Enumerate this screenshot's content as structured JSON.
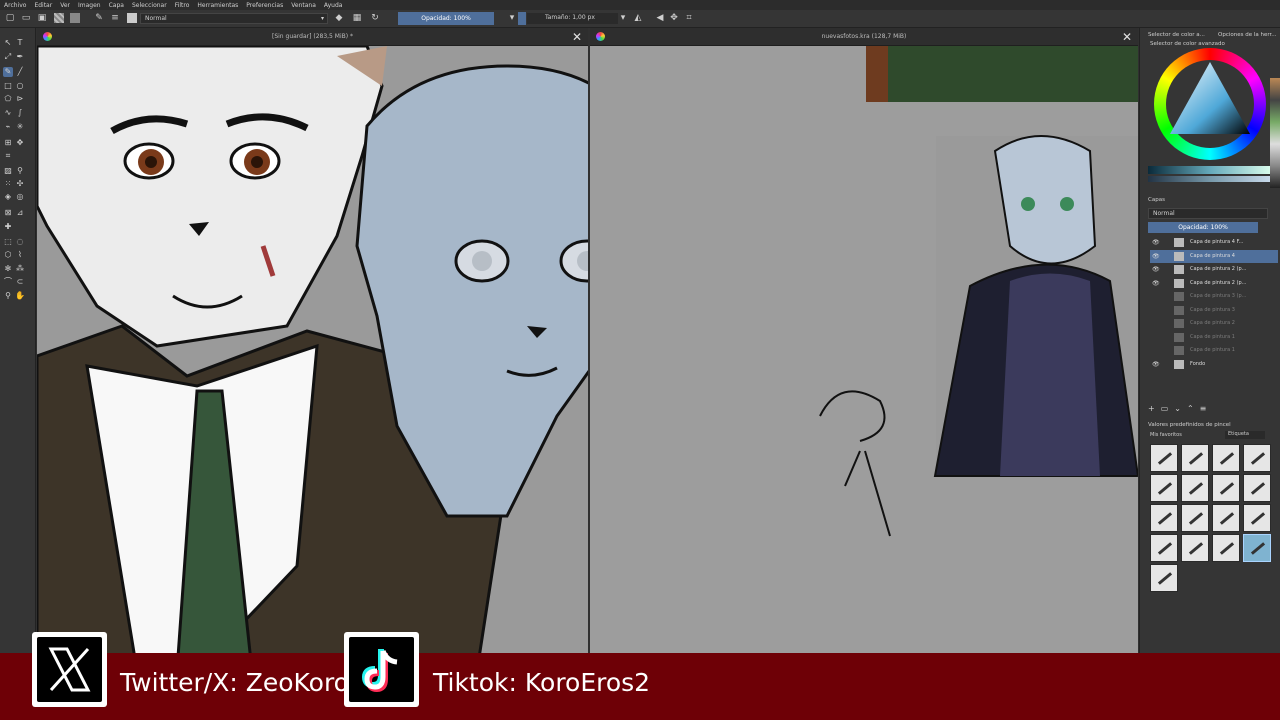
{
  "menu": {
    "items": [
      "Archivo",
      "Editar",
      "Ver",
      "Imagen",
      "Capa",
      "Seleccionar",
      "Filtro",
      "Herramientas",
      "Preferencias",
      "Ventana",
      "Ayuda"
    ]
  },
  "toolbar": {
    "blend_mode": "Normal",
    "opacity_label": "Opacidad: 100%",
    "size_label": "Tamaño: 1,00 px"
  },
  "canvases": [
    {
      "title": "[Sin guardar] (283,5 MiB) *"
    },
    {
      "title": "nuevasfotos.kra (128,7 MiB)"
    }
  ],
  "dock": {
    "color_panel_title": "Selector de color a...",
    "color_panel_title2": "Opciones de la herr...",
    "color_selector_label": "Selector de color avanzado",
    "layers_title": "Capas",
    "layers_blend": "Normal",
    "layers_opacity": "Opacidad: 100%",
    "layers": [
      {
        "name": "Capa de pintura 4 F...",
        "visible": true,
        "selected": false,
        "dim": false
      },
      {
        "name": "Capa de pintura 4",
        "visible": true,
        "selected": true,
        "dim": false
      },
      {
        "name": "Capa de pintura 2 (p...",
        "visible": true,
        "selected": false,
        "dim": false
      },
      {
        "name": "Capa de pintura 2 (p...",
        "visible": true,
        "selected": false,
        "dim": false
      },
      {
        "name": "Capa de pintura 3 (p...",
        "visible": false,
        "selected": false,
        "dim": true
      },
      {
        "name": "Capa de pintura 3",
        "visible": false,
        "selected": false,
        "dim": true
      },
      {
        "name": "Capa de pintura 2",
        "visible": false,
        "selected": false,
        "dim": true
      },
      {
        "name": "Capa de pintura 1",
        "visible": false,
        "selected": false,
        "dim": true
      },
      {
        "name": "Capa de pintura 1",
        "visible": false,
        "selected": false,
        "dim": true
      },
      {
        "name": "Fondo",
        "visible": true,
        "selected": false,
        "dim": false
      }
    ],
    "brush_title": "Valores predefinidos de pincel",
    "brush_favorites": "Mis favoritos",
    "brush_tag": "Etiqueta"
  },
  "social": {
    "twitter": "Twitter/X: ZeoKoro",
    "tiktok": "Tiktok: KoroEros2"
  },
  "colors": {
    "accent": "#4f6f9b",
    "banner": "#6e0006",
    "canvas_bg": "#9a9a9a"
  }
}
